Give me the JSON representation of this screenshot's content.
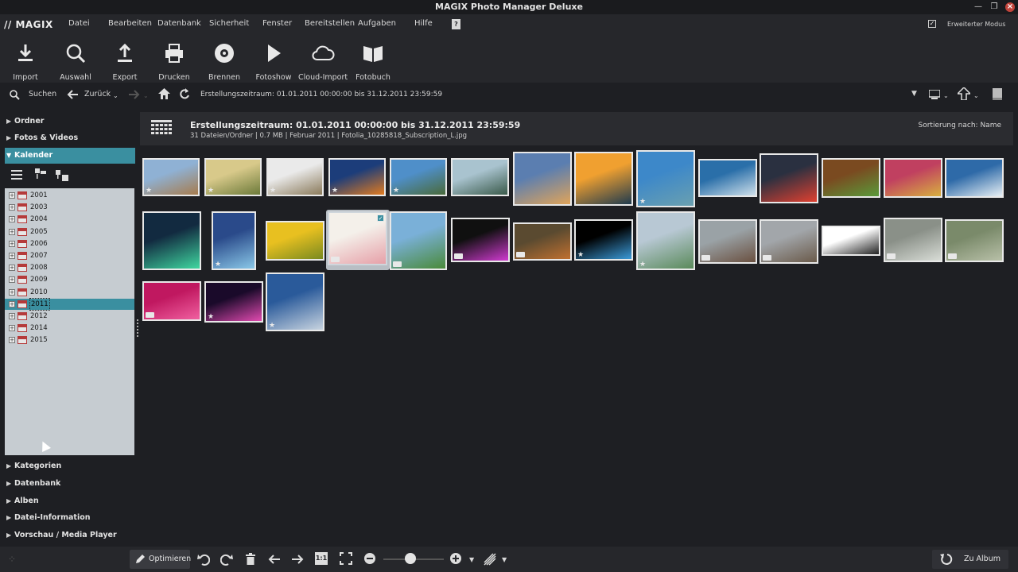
{
  "window": {
    "title": "MAGIX Photo Manager Deluxe"
  },
  "menubar": {
    "logo": "// MAGIX",
    "items": [
      {
        "label": "Datei"
      },
      {
        "label": "Bearbeiten"
      },
      {
        "label": "Datenbank"
      },
      {
        "label": "Sicherheit"
      },
      {
        "label": "Fenster"
      },
      {
        "label": "Bereitstellen"
      },
      {
        "label": "Aufgaben"
      },
      {
        "label": "Hilfe"
      }
    ],
    "extended_mode_label": "Erweiterter Modus",
    "extended_mode_checked": true
  },
  "toolbar": {
    "items": [
      {
        "label": "Import",
        "icon": "download-icon"
      },
      {
        "label": "Auswahl",
        "icon": "search-icon"
      },
      {
        "label": "Export",
        "icon": "upload-icon"
      },
      {
        "label": "Drucken",
        "icon": "printer-icon"
      },
      {
        "label": "Brennen",
        "icon": "disc-icon"
      },
      {
        "label": "Fotoshow",
        "icon": "play-icon"
      },
      {
        "label": "Cloud-Import",
        "icon": "cloud-icon"
      },
      {
        "label": "Fotobuch",
        "icon": "book-icon"
      }
    ]
  },
  "navbar": {
    "search_label": "Suchen",
    "back_label": "Zurück",
    "range_text": "Erstellungszeitraum:  01.01.2011 00:00:00 bis  31.12.2011 23:59:59"
  },
  "sidebar": {
    "sections_top": [
      {
        "label": "Ordner"
      },
      {
        "label": "Fotos & Videos"
      },
      {
        "label": "Kalender"
      }
    ],
    "years": [
      "2001",
      "2003",
      "2004",
      "2005",
      "2006",
      "2007",
      "2008",
      "2009",
      "2010",
      "2011",
      "2012",
      "2014",
      "2015"
    ],
    "selected_year": "2011",
    "sections_bottom": [
      {
        "label": "Kategorien"
      },
      {
        "label": "Datenbank"
      },
      {
        "label": "Alben"
      },
      {
        "label": "Datei-Information"
      },
      {
        "label": "Vorschau / Media Player"
      }
    ]
  },
  "header": {
    "title": "Erstellungszeitraum:  01.01.2011 00:00:00 bis  31.12.2011 23:59:59",
    "subtitle": "31 Dateien/Ordner | 0.7 MB | Februar 2011 | Fotolia_10285818_Subscription_L.jpg",
    "sort_label": "Sortierung nach: Name"
  },
  "thumbnails": [
    {
      "badge": "star",
      "colors": [
        "#8fb1d4",
        "#a67c4e"
      ]
    },
    {
      "badge": "star",
      "colors": [
        "#d8c98a",
        "#6c7a3a"
      ]
    },
    {
      "badge": "star",
      "colors": [
        "#eaeaea",
        "#8a7a5a"
      ]
    },
    {
      "badge": "star",
      "colors": [
        "#1c3d7a",
        "#e07a20"
      ]
    },
    {
      "badge": "star",
      "colors": [
        "#4f8fc9",
        "#4a6a3a"
      ]
    },
    {
      "badge": "none",
      "colors": [
        "#a9c3cf",
        "#3a5a4a"
      ]
    },
    {
      "badge": "none",
      "colors": [
        "#5b7eb0",
        "#e0a45a"
      ]
    },
    {
      "badge": "none",
      "colors": [
        "#f0a030",
        "#1e3a4e"
      ]
    },
    {
      "badge": "star",
      "colors": [
        "#3d88c9",
        "#6aa0b0"
      ]
    },
    {
      "badge": "none",
      "colors": [
        "#2a6fa9",
        "#cfe0ea"
      ]
    },
    {
      "badge": "none",
      "colors": [
        "#2a3040",
        "#e04030"
      ]
    },
    {
      "badge": "none",
      "colors": [
        "#7a4a20",
        "#5a9a3a"
      ]
    },
    {
      "badge": "none",
      "colors": [
        "#c04060",
        "#d8b040"
      ]
    },
    {
      "badge": "none",
      "colors": [
        "#2e6aa8",
        "#e8f0f4"
      ]
    },
    {
      "badge": "none",
      "colors": [
        "#122a40",
        "#3fd7a0"
      ]
    },
    {
      "badge": "star",
      "colors": [
        "#2a4a8a",
        "#8ac8e8"
      ]
    },
    {
      "badge": "none",
      "colors": [
        "#e8c020",
        "#7a8a20"
      ]
    },
    {
      "badge": "flag",
      "colors": [
        "#f4f0ea",
        "#e6a0a8"
      ],
      "selected": true
    },
    {
      "badge": "flag",
      "colors": [
        "#7ab0d8",
        "#4a8a3a"
      ]
    },
    {
      "badge": "flag",
      "colors": [
        "#101010",
        "#d03ad0"
      ]
    },
    {
      "badge": "flag",
      "colors": [
        "#5a4a30",
        "#c07030"
      ]
    },
    {
      "badge": "star",
      "colors": [
        "#000000",
        "#3a9ad8"
      ]
    },
    {
      "badge": "star",
      "colors": [
        "#b8c8d4",
        "#5a8a5a"
      ]
    },
    {
      "badge": "flag",
      "colors": [
        "#9aa2a6",
        "#6a5040"
      ]
    },
    {
      "badge": "flag",
      "colors": [
        "#a2a6aa",
        "#6a5a4a"
      ]
    },
    {
      "badge": "none",
      "colors": [
        "#ffffff",
        "#222222"
      ]
    },
    {
      "badge": "flag",
      "colors": [
        "#8a9088",
        "#d8dcd6"
      ]
    },
    {
      "badge": "flag",
      "colors": [
        "#7a8a6a",
        "#b8c0a8"
      ]
    },
    {
      "badge": "flag",
      "colors": [
        "#c01860",
        "#f060a0"
      ]
    },
    {
      "badge": "star",
      "colors": [
        "#1a0a2a",
        "#e04ab0"
      ]
    },
    {
      "badge": "star",
      "colors": [
        "#2a5a9a",
        "#c8d4e0"
      ]
    }
  ],
  "bottombar": {
    "optimize_label": "Optimieren",
    "to_album_label": "Zu Album",
    "one_to_one_label": "1:1"
  }
}
